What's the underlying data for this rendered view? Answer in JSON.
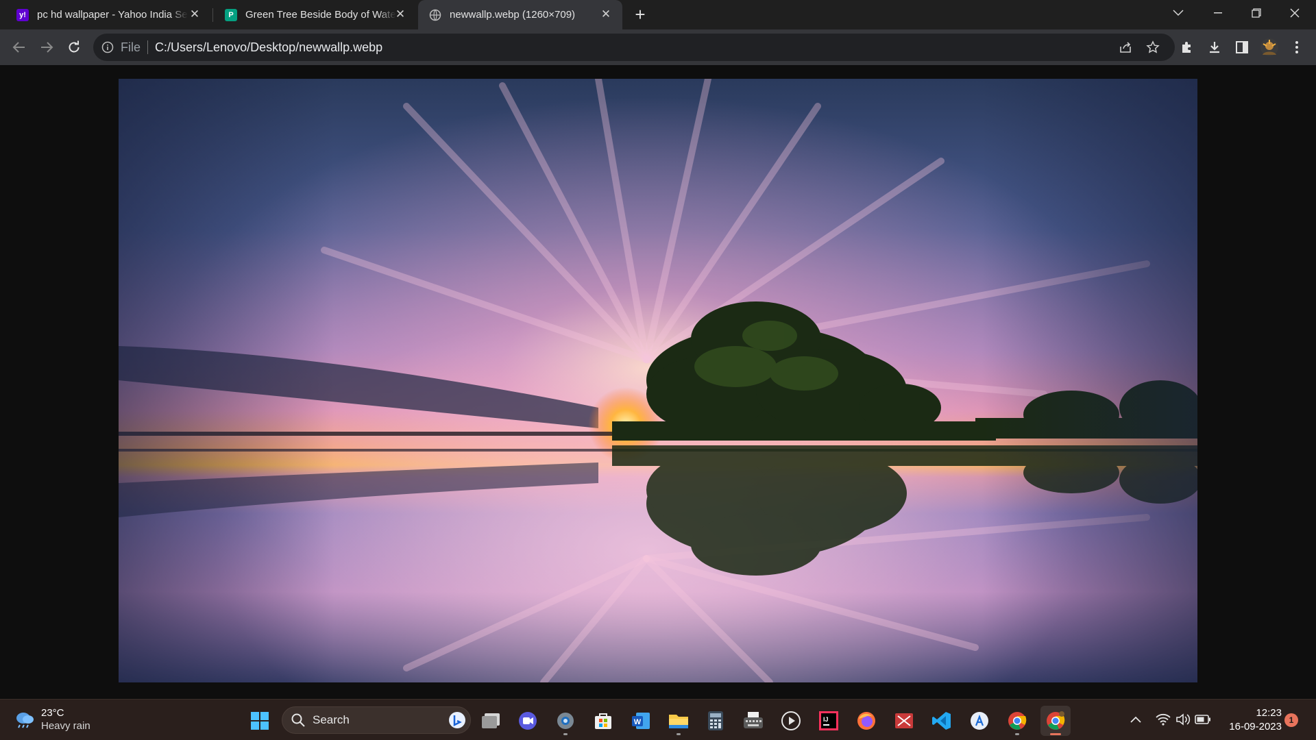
{
  "browser": {
    "tabs": [
      {
        "title": "pc hd wallpaper - Yahoo India Se",
        "favicon": "yahoo-icon",
        "favicon_text": "y!",
        "favicon_color": "#5f01d1",
        "active": false
      },
      {
        "title": "Green Tree Beside Body of Water",
        "favicon": "pexels-icon",
        "favicon_text": "P",
        "favicon_color": "#05a081",
        "active": false
      },
      {
        "title": "newwallp.webp (1260×709)",
        "favicon": "globe-icon",
        "favicon_text": "",
        "favicon_color": "#35363a",
        "active": true
      }
    ],
    "omnibox": {
      "scheme_label": "File",
      "url": "C:/Users/Lenovo/Desktop/newwallp.webp"
    }
  },
  "content": {
    "image_description_icon": "landscape-image"
  },
  "taskbar": {
    "weather": {
      "temp": "23°C",
      "desc": "Heavy rain"
    },
    "search_label": "Search",
    "apps": [
      "start-icon",
      "search",
      "copilot-icon",
      "task-view-icon",
      "meet-icon",
      "settings-icon",
      "store-icon",
      "word-icon",
      "file-explorer-icon",
      "calculator-icon",
      "typewriter-app-icon",
      "media-player-icon",
      "intellij-icon",
      "firefox-icon",
      "snipping-tool-icon",
      "vscode-icon",
      "app-store-icon",
      "chrome-icon",
      "chrome-profile-icon"
    ],
    "clock": {
      "time": "12:23",
      "date": "16-09-2023"
    },
    "notification_count": "1"
  },
  "colors": {
    "tabstrip_bg": "#1f1f1f",
    "toolbar_bg": "#35363a",
    "omnibox_bg": "#202124",
    "taskbar_bg": "#2a1f1c",
    "accent": "#e8745c"
  }
}
